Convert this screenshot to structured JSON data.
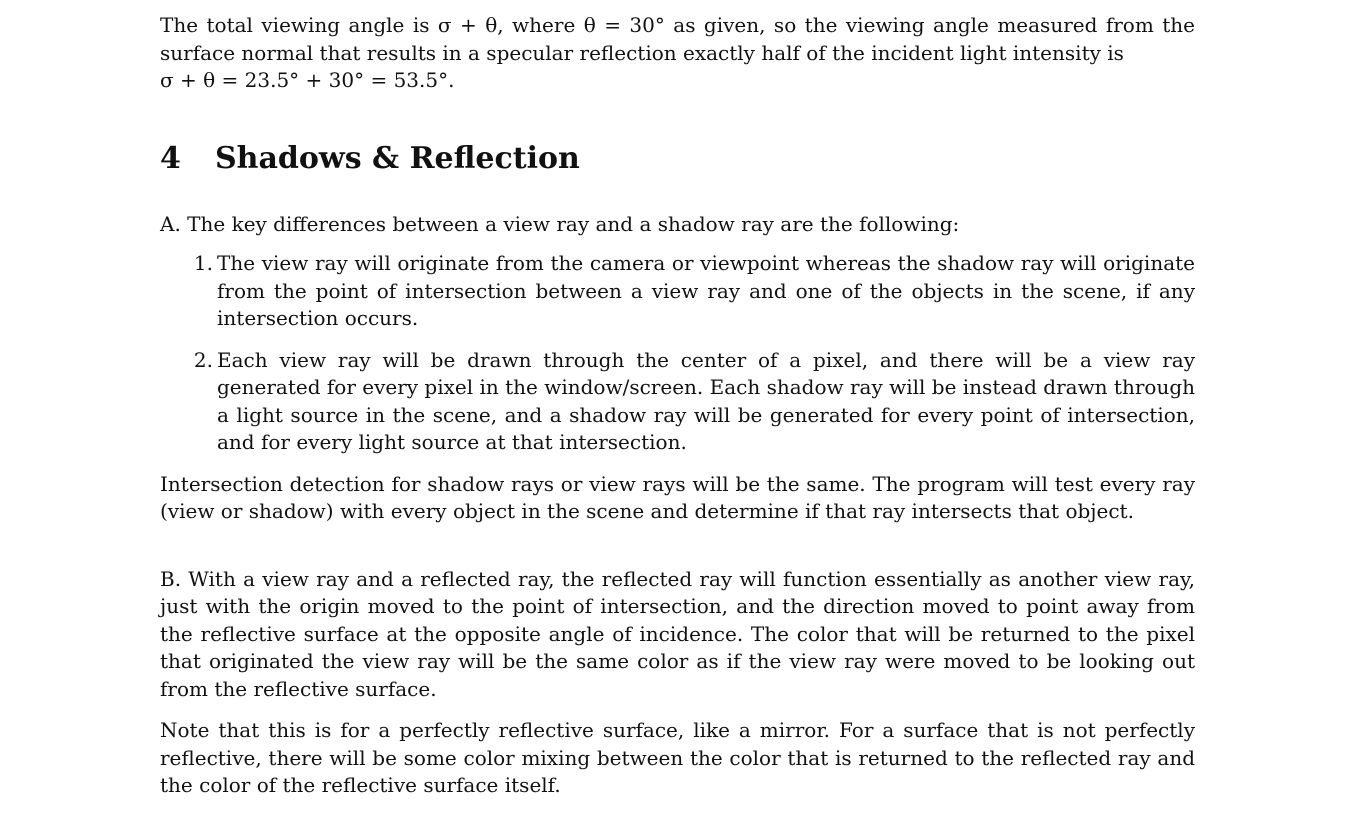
{
  "intro": {
    "line1": "The total viewing angle is σ + θ, where θ = 30° as given, so the viewing angle measured from the surface normal that results in a specular reflection exactly half of the incident light intensity is",
    "equation": "σ + θ = 23.5° + 30° = 53.5°."
  },
  "section": {
    "number": "4",
    "title": "Shadows & Reflection"
  },
  "part_a": {
    "lead": "A. The key differences between a view ray and a shadow ray are the following:",
    "items": [
      {
        "num": "1.",
        "text": "The view ray will originate from the camera or viewpoint whereas the shadow ray will originate from the point of intersection between a view ray and one of the objects in the scene, if any intersection occurs."
      },
      {
        "num": "2.",
        "text": "Each view ray will be drawn through the center of a pixel, and there will be a view ray generated for every pixel in the window/screen. Each shadow ray will be instead drawn through a light source in the scene, and a shadow ray will be generated for every point of intersection, and for every light source at that intersection."
      }
    ],
    "detection": "Intersection detection for shadow rays or view rays will be the same. The program will test every ray (view or shadow) with every object in the scene and determine if that ray intersects that object."
  },
  "part_b": {
    "text": "B. With a view ray and a reflected ray, the reflected ray will function essentially as another view ray, just with the origin moved to the point of intersection, and the direction moved to point away from the reflective surface at the opposite angle of incidence. The color that will be returned to the pixel that originated the view ray will be the same color as if the view ray were moved to be looking out from the reflective surface.",
    "note": "Note that this is for a perfectly reflective surface, like a mirror. For a surface that is not perfectly reflective, there will be some color mixing between the color that is returned to the reflected ray and the color of the reflective surface itself."
  }
}
